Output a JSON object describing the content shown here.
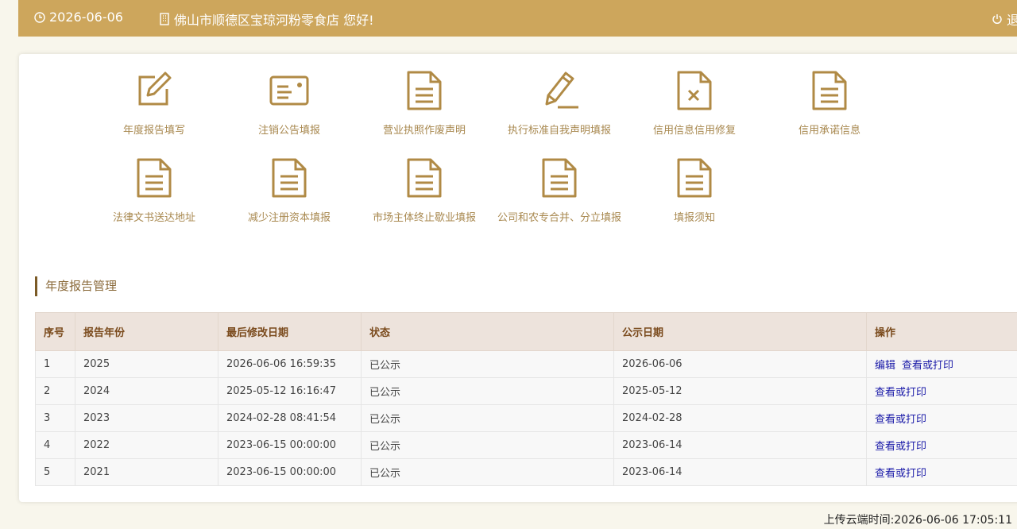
{
  "header": {
    "date": "2026-06-06",
    "greeting": "佛山市顺德区宝琼河粉零食店 您好!",
    "logout_label": "退出"
  },
  "accent_color": "#cda65c",
  "icon_color": "#b08a45",
  "functions": [
    {
      "label": "年度报告填写",
      "icon": "edit-icon"
    },
    {
      "label": "注销公告填报",
      "icon": "id-card-icon"
    },
    {
      "label": "营业执照作废声明",
      "icon": "document-icon"
    },
    {
      "label": "执行标准自我声明填报",
      "icon": "pencil-icon"
    },
    {
      "label": "信用信息信用修复",
      "icon": "document-x-icon"
    },
    {
      "label": "信用承诺信息",
      "icon": "document-icon"
    },
    {
      "label": "法律文书送达地址",
      "icon": "document-icon"
    },
    {
      "label": "减少注册资本填报",
      "icon": "document-icon"
    },
    {
      "label": "市场主体终止歇业填报",
      "icon": "document-icon"
    },
    {
      "label": "公司和农专合并、分立填报",
      "icon": "document-icon"
    },
    {
      "label": "填报须知",
      "icon": "document-icon"
    }
  ],
  "section": {
    "title": "年度报告管理"
  },
  "table": {
    "columns": [
      "序号",
      "报告年份",
      "最后修改日期",
      "状态",
      "公示日期",
      "操作"
    ],
    "rows": [
      {
        "no": "1",
        "year": "2025",
        "modified": "2026-06-06 16:59:35",
        "status": "已公示",
        "published": "2026-06-06",
        "actions": [
          "编辑",
          "查看或打印"
        ]
      },
      {
        "no": "2",
        "year": "2024",
        "modified": "2025-05-12 16:16:47",
        "status": "已公示",
        "published": "2025-05-12",
        "actions": [
          "查看或打印"
        ]
      },
      {
        "no": "3",
        "year": "2023",
        "modified": "2024-02-28 08:41:54",
        "status": "已公示",
        "published": "2024-02-28",
        "actions": [
          "查看或打印"
        ]
      },
      {
        "no": "4",
        "year": "2022",
        "modified": "2023-06-15 00:00:00",
        "status": "已公示",
        "published": "2023-06-14",
        "actions": [
          "查看或打印"
        ]
      },
      {
        "no": "5",
        "year": "2021",
        "modified": "2023-06-15 00:00:00",
        "status": "已公示",
        "published": "2023-06-14",
        "actions": [
          "查看或打印"
        ]
      }
    ]
  },
  "footer": {
    "upload_time": "上传云端时间:2026-06-06 17:05:11"
  }
}
